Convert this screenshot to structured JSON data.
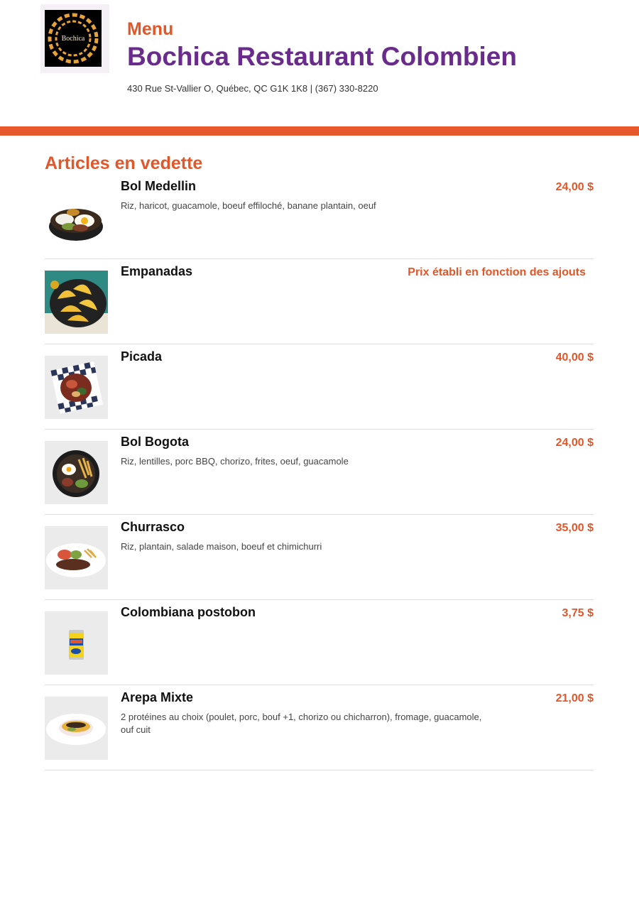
{
  "header": {
    "menu_label": "Menu",
    "restaurant_name": "Bochica Restaurant Colombien",
    "address_line": "430 Rue St-Vallier O, Québec, QC G1K 1K8 | (367) 330-8220",
    "logo_text": "Bochica"
  },
  "colors": {
    "accent_orange": "#e8582d",
    "title_purple": "#6a2c8c"
  },
  "section": {
    "title": "Articles en vedette",
    "items": [
      {
        "name": "Bol Medellin",
        "price": "24,00 $",
        "description": "Riz, haricot, guacamole, boeuf effiloché, banane plantain, oeuf",
        "image_icon": "bowl-medellin-photo"
      },
      {
        "name": "Empanadas",
        "price": "Prix établi en fonction des ajouts",
        "description": "",
        "image_icon": "empanadas-photo"
      },
      {
        "name": "Picada",
        "price": "40,00 $",
        "description": "",
        "image_icon": "picada-photo"
      },
      {
        "name": "Bol Bogota",
        "price": "24,00 $",
        "description": "Riz, lentilles, porc BBQ, chorizo, frites, oeuf, guacamole",
        "image_icon": "bowl-bogota-photo"
      },
      {
        "name": "Churrasco",
        "price": "35,00 $",
        "description": "Riz, plantain, salade maison, boeuf et chimichurri",
        "image_icon": "churrasco-photo"
      },
      {
        "name": "Colombiana postobon",
        "price": "3,75 $",
        "description": "",
        "image_icon": "soda-can-photo"
      },
      {
        "name": "Arepa Mixte",
        "price": "21,00 $",
        "description": "2 protéines au choix (poulet, porc, bouf +1, chorizo ou chicharron), fromage, guacamole, ouf cuit",
        "image_icon": "arepa-photo"
      }
    ]
  }
}
